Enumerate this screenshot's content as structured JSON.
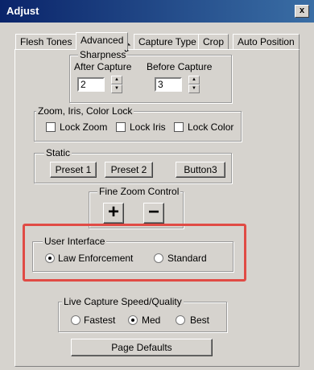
{
  "window": {
    "title": "Adjust",
    "close_label": "x"
  },
  "tabs": [
    {
      "label": "Flesh Tones"
    },
    {
      "label": "Advanced"
    },
    {
      "label": "Capture Type"
    },
    {
      "label": "Crop"
    },
    {
      "label": "Auto Position"
    }
  ],
  "active_tab": "Advanced",
  "sharpness": {
    "title": "Sharpness",
    "after_label": "After Capture",
    "after_value": "2",
    "before_label": "Before Capture",
    "before_value": "3"
  },
  "zoom_lock": {
    "title": "Zoom, Iris, Color Lock",
    "lock_zoom": "Lock Zoom",
    "lock_iris": "Lock Iris",
    "lock_color": "Lock Color"
  },
  "static": {
    "title": "Static",
    "preset1": "Preset 1",
    "preset2": "Preset 2",
    "button3": "Button3"
  },
  "fine_zoom": {
    "title": "Fine Zoom Control",
    "plus": "+",
    "minus": "−"
  },
  "user_interface": {
    "title": "User Interface",
    "law": "Law Enforcement",
    "standard": "Standard",
    "selected": "Law Enforcement"
  },
  "live_capture": {
    "title": "Live Capture Speed/Quality",
    "fastest": "Fastest",
    "med": "Med",
    "best": "Best",
    "selected": "Med"
  },
  "page_defaults": "Page Defaults",
  "colors": {
    "title_start": "#0a246a",
    "title_end": "#3a6ea5",
    "highlight": "#e04b45",
    "face": "#d6d3ce"
  }
}
